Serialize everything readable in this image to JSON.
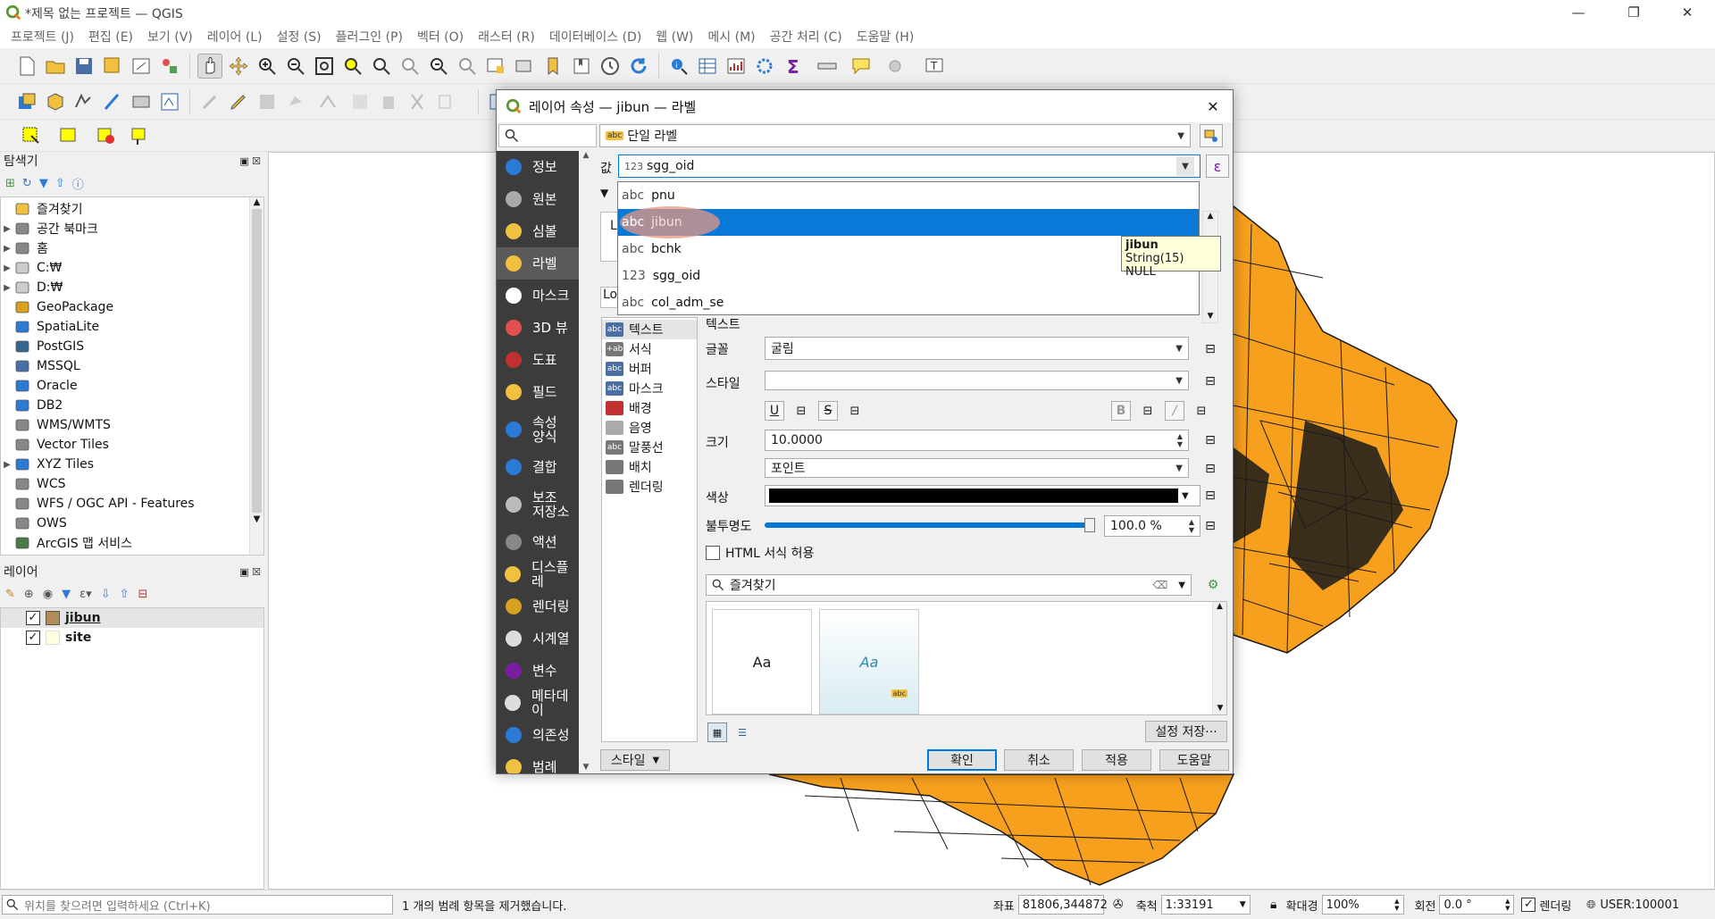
{
  "window": {
    "title": "*제목 없는 프로젝트 — QGIS",
    "minimize": "—",
    "restore": "❐",
    "close": "✕"
  },
  "menu": [
    "프로젝트 (J)",
    "편집 (E)",
    "보기 (V)",
    "레이어 (L)",
    "설정 (S)",
    "플러그인 (P)",
    "벡터 (O)",
    "래스터 (R)",
    "데이터베이스 (D)",
    "웹 (W)",
    "메시 (M)",
    "공간 처리 (C)",
    "도움말 (H)"
  ],
  "browser": {
    "title": "탐색기",
    "items": [
      {
        "label": "즐겨찾기",
        "icon": "star-icon",
        "arrow": ""
      },
      {
        "label": "공간 북마크",
        "icon": "bookmark-icon",
        "arrow": "▶"
      },
      {
        "label": "홈",
        "icon": "home-icon",
        "arrow": "▶"
      },
      {
        "label": "C:₩",
        "icon": "folder-icon",
        "arrow": "▶"
      },
      {
        "label": "D:₩",
        "icon": "folder-icon",
        "arrow": "▶"
      },
      {
        "label": "GeoPackage",
        "icon": "geopackage-icon",
        "arrow": ""
      },
      {
        "label": "SpatiaLite",
        "icon": "spatialite-icon",
        "arrow": ""
      },
      {
        "label": "PostGIS",
        "icon": "postgis-icon",
        "arrow": ""
      },
      {
        "label": "MSSQL",
        "icon": "mssql-icon",
        "arrow": ""
      },
      {
        "label": "Oracle",
        "icon": "oracle-icon",
        "arrow": ""
      },
      {
        "label": "DB2",
        "icon": "db2-icon",
        "arrow": ""
      },
      {
        "label": "WMS/WMTS",
        "icon": "wms-icon",
        "arrow": ""
      },
      {
        "label": "Vector Tiles",
        "icon": "vector-tiles-icon",
        "arrow": ""
      },
      {
        "label": "XYZ Tiles",
        "icon": "xyz-tiles-icon",
        "arrow": "▶"
      },
      {
        "label": "WCS",
        "icon": "wcs-icon",
        "arrow": ""
      },
      {
        "label": "WFS / OGC API - Features",
        "icon": "wfs-icon",
        "arrow": ""
      },
      {
        "label": "OWS",
        "icon": "ows-icon",
        "arrow": ""
      },
      {
        "label": "ArcGIS 맵 서비스",
        "icon": "arcgis-icon",
        "arrow": ""
      }
    ]
  },
  "layers": {
    "title": "레이어",
    "items": [
      {
        "label": "jibun",
        "color": "#b08d57",
        "checked": "✓"
      },
      {
        "label": "site",
        "color": "#ffffe0",
        "checked": "✓"
      }
    ]
  },
  "dialog": {
    "title": "레이어 속성 — jibun — 라벨",
    "close": "✕",
    "search_placeholder": "",
    "nav": [
      {
        "label": "정보",
        "icon": "info-icon"
      },
      {
        "label": "원본",
        "icon": "source-icon"
      },
      {
        "label": "심볼",
        "icon": "symbology-icon"
      },
      {
        "label": "라벨",
        "icon": "labels-icon"
      },
      {
        "label": "마스크",
        "icon": "mask-icon"
      },
      {
        "label": "3D 뷰",
        "icon": "3d-view-icon"
      },
      {
        "label": "도표",
        "icon": "diagram-icon"
      },
      {
        "label": "필드",
        "icon": "fields-icon"
      },
      {
        "label": "속성\n양식",
        "icon": "attributes-form-icon"
      },
      {
        "label": "결합",
        "icon": "joins-icon"
      },
      {
        "label": "보조\n저장소",
        "icon": "auxiliary-storage-icon"
      },
      {
        "label": "액션",
        "icon": "actions-icon"
      },
      {
        "label": "디스플레",
        "icon": "display-icon"
      },
      {
        "label": "렌더링",
        "icon": "rendering-icon"
      },
      {
        "label": "시계열",
        "icon": "temporal-icon"
      },
      {
        "label": "변수",
        "icon": "variables-icon"
      },
      {
        "label": "메타데이",
        "icon": "metadata-icon"
      },
      {
        "label": "의존성",
        "icon": "dependencies-icon"
      },
      {
        "label": "범례",
        "icon": "legend-icon"
      }
    ],
    "label_mode": "단일 라벨",
    "value_label": "값",
    "value_field": "sgg_oid",
    "value_type": "123",
    "stub_lo": "Lo",
    "stub_l": "L",
    "subtree": [
      {
        "label": "텍스트",
        "icon": "abc"
      },
      {
        "label": "서식",
        "icon": "+ab"
      },
      {
        "label": "버퍼",
        "icon": "abc"
      },
      {
        "label": "마스크",
        "icon": "abc"
      },
      {
        "label": "배경",
        "icon": ""
      },
      {
        "label": "음영",
        "icon": ""
      },
      {
        "label": "말풍선",
        "icon": "abc"
      },
      {
        "label": "배치",
        "icon": ""
      },
      {
        "label": "렌더링",
        "icon": ""
      }
    ],
    "section_title": "텍스트",
    "font_label": "글꼴",
    "font_value": "굴림",
    "style_label": "스타일",
    "style_value": "",
    "size_label": "크기",
    "size_value": "10.0000",
    "unit_value": "포인트",
    "color_label": "색상",
    "opacity_label": "불투명도",
    "opacity_value": "100.0 %",
    "opacity_level": 1.0,
    "html_label": "HTML 서식 허용",
    "fav_placeholder": "즐겨찾기",
    "preview_text": "Aa",
    "preview_text2": "Aa",
    "save_settings": "설정 저장···",
    "style_button": "스타일",
    "ok": "확인",
    "cancel": "취소",
    "apply": "적용",
    "help": "도움말"
  },
  "dropdown": {
    "options": [
      {
        "type": "abc",
        "name": "pnu",
        "selected": false
      },
      {
        "type": "abc",
        "name": "jibun",
        "selected": true
      },
      {
        "type": "abc",
        "name": "bchk",
        "selected": false
      },
      {
        "type": "123",
        "name": "sgg_oid",
        "selected": false
      },
      {
        "type": "abc",
        "name": "col_adm_se",
        "selected": false
      }
    ]
  },
  "tooltip": {
    "name": "jibun",
    "detail": "String(15) NULL"
  },
  "statusbar": {
    "search_placeholder": "위치를 찾으려면 입력하세요 (Ctrl+K)",
    "message": "1 개의 범례 항목을 제거했습니다.",
    "coord_label": "좌표",
    "coord_value": "81806,344872",
    "scale_label": "축척",
    "scale_value": "1:33191",
    "magnifier_label": "확대경",
    "magnifier_value": "100%",
    "rotation_label": "회전",
    "rotation_value": "0.0 °",
    "render_label": "렌더링",
    "crs": "USER:100001"
  },
  "colors": {
    "accent": "#0a78d7",
    "map_fill": "#f7a01e",
    "nav_bg": "#3c3c3c"
  }
}
